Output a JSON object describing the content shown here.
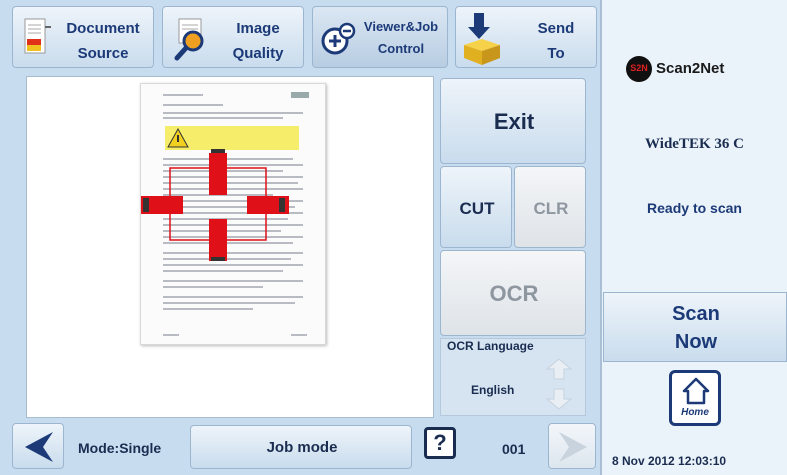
{
  "toolbar": {
    "document_source": {
      "line1": "Document",
      "line2": "Source",
      "icon": "document-source-icon"
    },
    "image_quality": {
      "line1": "Image",
      "line2": "Quality",
      "icon": "magnifier-icon"
    },
    "viewer_job_control": {
      "line1": "Viewer&Job",
      "line2": "Control",
      "icon": "zoom-out-icon"
    },
    "send_to": {
      "line1": "Send",
      "line2": "To",
      "icon": "send-box-icon"
    }
  },
  "controls": {
    "exit": "Exit",
    "cut": "CUT",
    "clr": "CLR",
    "ocr": "OCR",
    "ocr_language_label": "OCR Language",
    "ocr_language_value": "English"
  },
  "bottom_bar": {
    "mode": "Mode:Single",
    "job_mode": "Job mode",
    "help": "?",
    "page_number": "001"
  },
  "right_panel": {
    "logo_text": "Scan2Net",
    "logo_badge": "S2N",
    "device_name": "WideTEK 36 C",
    "status": "Ready to scan",
    "scan_now_line1": "Scan",
    "scan_now_line2": "Now",
    "home_label": "Home",
    "datetime": "8 Nov 2012 12:03:10"
  },
  "colors": {
    "accent": "#1c3a78",
    "panel": "#c8dcef",
    "crosshair": "#e01018"
  }
}
